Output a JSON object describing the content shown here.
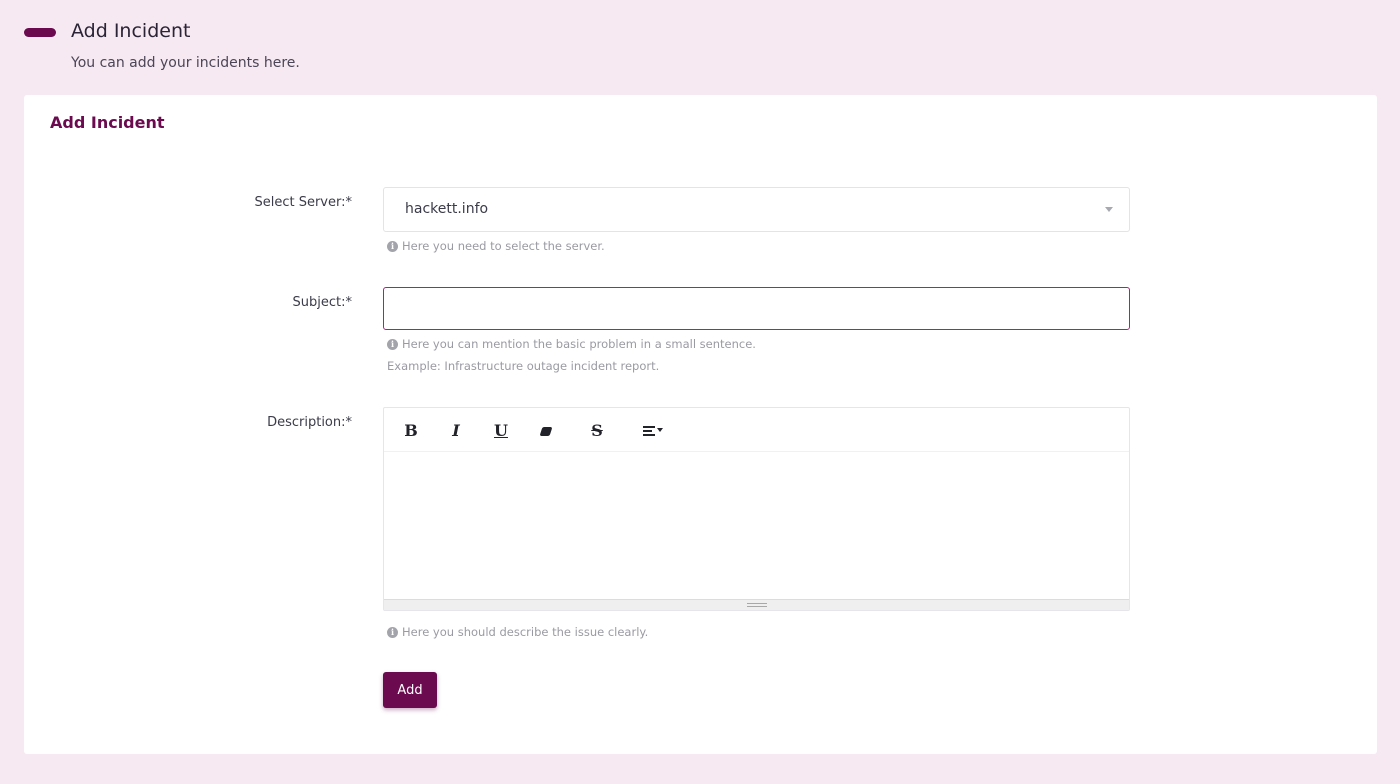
{
  "header": {
    "title": "Add Incident",
    "subtitle": "You can add your incidents here."
  },
  "card": {
    "title": "Add Incident"
  },
  "form": {
    "server": {
      "label": "Select Server:*",
      "value": "hackett.info",
      "help": "Here you need to select the server."
    },
    "subject": {
      "label": "Subject:*",
      "value": "",
      "help": "Here you can mention the basic problem in a small sentence.",
      "example": "Example: Infrastructure outage incident report."
    },
    "description": {
      "label": "Description:*",
      "help": "Here you should describe the issue clearly.",
      "toolbar": {
        "bold": "B",
        "italic": "I",
        "underline": "U",
        "strike": "S"
      }
    },
    "submit_label": "Add"
  },
  "icons": {
    "info": "i"
  },
  "colors": {
    "accent": "#6b0a4f",
    "background": "#f6e9f2",
    "focus_border": "#a8227e"
  }
}
